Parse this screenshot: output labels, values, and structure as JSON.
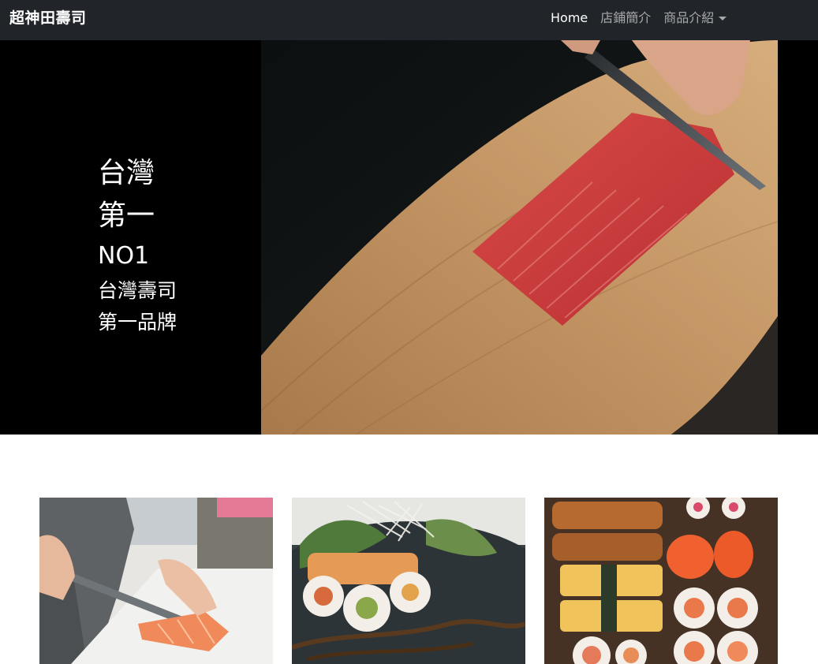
{
  "navbar": {
    "brand": "超神田壽司",
    "links": [
      {
        "label": "Home",
        "active": true
      },
      {
        "label": "店鋪簡介",
        "active": false
      },
      {
        "label": "商品介紹",
        "active": false,
        "dropdown": true
      }
    ]
  },
  "hero": {
    "lines": [
      "台灣",
      "第一",
      "NO1",
      "台灣壽司",
      "第一品牌"
    ]
  },
  "colors": {
    "navbar_bg": "#212529",
    "hero_bg": "#000000"
  },
  "images": [
    {
      "subject": "hero-tuna-cutting-board"
    },
    {
      "subject": "salmon-slicing"
    },
    {
      "subject": "sushi-roll-plate"
    },
    {
      "subject": "sushi-platter"
    }
  ]
}
